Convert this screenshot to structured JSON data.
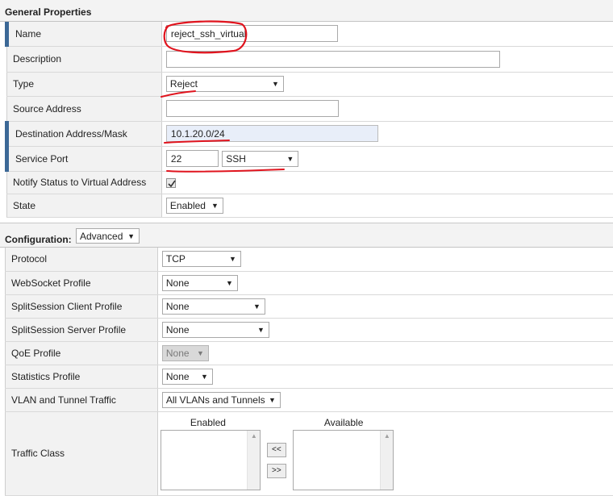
{
  "general": {
    "title": "General Properties",
    "name": {
      "label": "Name",
      "value": "reject_ssh_virtual"
    },
    "description": {
      "label": "Description",
      "value": ""
    },
    "type": {
      "label": "Type",
      "value": "Reject"
    },
    "source_address": {
      "label": "Source Address",
      "value": ""
    },
    "destination": {
      "label": "Destination Address/Mask",
      "value": "10.1.20.0/24"
    },
    "service_port": {
      "label": "Service Port",
      "port": "22",
      "service": "SSH"
    },
    "notify": {
      "label": "Notify Status to Virtual Address",
      "checked": true
    },
    "state": {
      "label": "State",
      "value": "Enabled"
    }
  },
  "configuration": {
    "title": "Configuration:",
    "mode": "Advanced",
    "protocol": {
      "label": "Protocol",
      "value": "TCP"
    },
    "websocket": {
      "label": "WebSocket Profile",
      "value": "None"
    },
    "ss_client": {
      "label": "SplitSession Client Profile",
      "value": "None"
    },
    "ss_server": {
      "label": "SplitSession Server Profile",
      "value": "None"
    },
    "qoe": {
      "label": "QoE Profile",
      "value": "None"
    },
    "statistics": {
      "label": "Statistics Profile",
      "value": "None"
    },
    "vlan": {
      "label": "VLAN and Tunnel Traffic",
      "value": "All VLANs and Tunnels"
    },
    "traffic_class": {
      "label": "Traffic Class",
      "enabled_header": "Enabled",
      "available_header": "Available",
      "move_left": "<<",
      "move_right": ">>"
    }
  },
  "colors": {
    "required_marker": "#3c6896",
    "annotation": "#e0141e"
  }
}
